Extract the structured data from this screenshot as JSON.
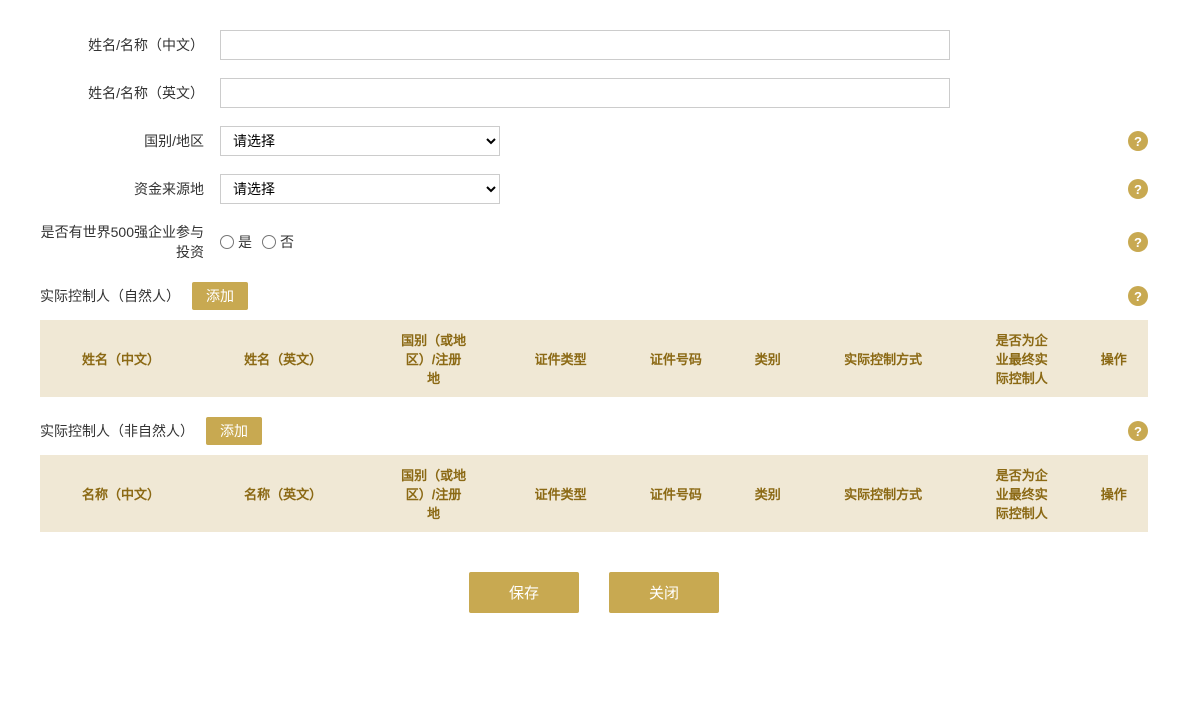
{
  "form": {
    "name_cn_label": "姓名/名称（中文）",
    "name_en_label": "姓名/名称（英文）",
    "country_label": "国别/地区",
    "country_placeholder": "请选择",
    "fund_source_label": "资金来源地",
    "fund_source_placeholder": "请选择",
    "fortune500_label": "是否有世界500强企业参与投资",
    "radio_yes": "是",
    "radio_no": "否"
  },
  "natural_section": {
    "title": "实际控制人（自然人）",
    "add_btn": "添加",
    "columns": [
      "姓名（中文）",
      "姓名（英文）",
      "国别（或地区）/注册地",
      "证件类型",
      "证件号码",
      "类别",
      "实际控制方式",
      "是否为企业最终实际控制人",
      "操作"
    ]
  },
  "non_natural_section": {
    "title": "实际控制人（非自然人）",
    "add_btn": "添加",
    "columns": [
      "名称（中文）",
      "名称（英文）",
      "国别（或地区）/注册地",
      "证件类型",
      "证件号码",
      "类别",
      "实际控制方式",
      "是否为企业最终实际控制人",
      "操作"
    ]
  },
  "buttons": {
    "save": "保存",
    "close": "关闭"
  },
  "help": "?"
}
